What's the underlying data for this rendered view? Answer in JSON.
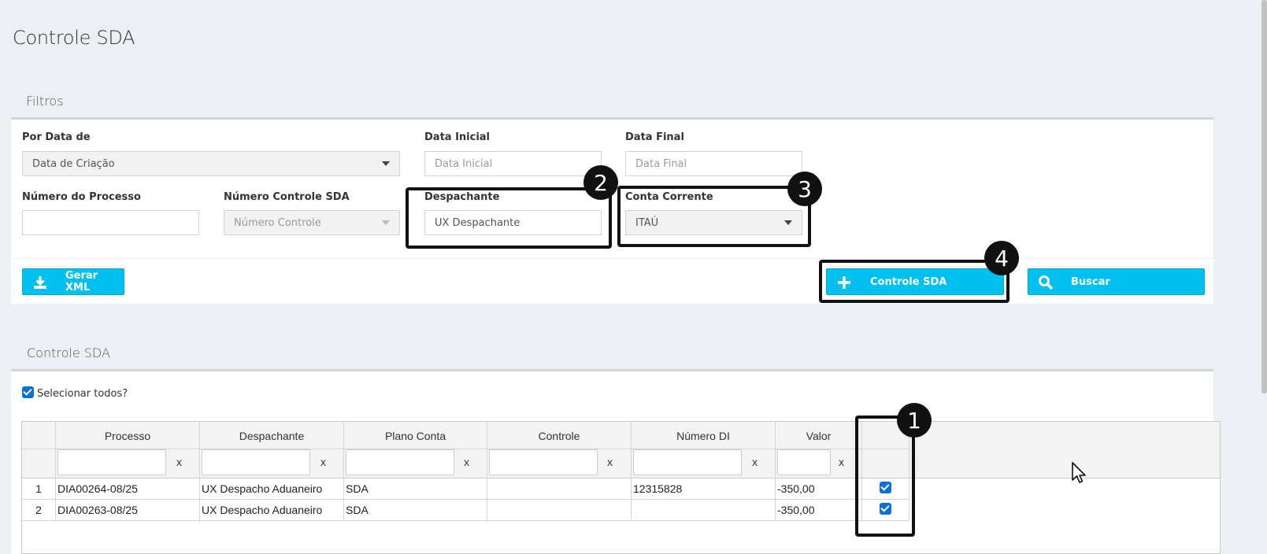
{
  "page": {
    "title": "Controle SDA"
  },
  "filters": {
    "section_title": "Filtros",
    "por_data_label": "Por Data de",
    "por_data_value": "Data de Criação",
    "data_inicial_label": "Data Inicial",
    "data_inicial_placeholder": "Data Inicial",
    "data_final_label": "Data Final",
    "data_final_placeholder": "Data Final",
    "numero_processo_label": "Número do Processo",
    "numero_processo_value": "",
    "numero_controle_label": "Número Controle SDA",
    "numero_controle_placeholder": "Número Controle",
    "despachante_label": "Despachante",
    "despachante_value": "UX Despachante",
    "conta_corrente_label": "Conta Corrente",
    "conta_corrente_value": "ITAÚ"
  },
  "actions": {
    "gerar_xml": "Gerar XML",
    "controle_sda": "Controle SDA",
    "buscar": "Buscar"
  },
  "results": {
    "section_title": "Controle SDA",
    "select_all_label": "Selecionar todos?",
    "select_all_checked": true,
    "columns": [
      "Processo",
      "Despachante",
      "Plano Conta",
      "Controle",
      "Número DI",
      "Valor"
    ],
    "filter_clear": "x",
    "rows": [
      {
        "n": "1",
        "processo": "DIA00264-08/25",
        "despachante": "UX Despacho Aduaneiro",
        "plano_conta": "SDA",
        "controle": "",
        "numero_di": "12315828",
        "valor": "-350,00",
        "checked": true
      },
      {
        "n": "2",
        "processo": "DIA00263-08/25",
        "despachante": "UX Despacho Aduaneiro",
        "plano_conta": "SDA",
        "controle": "",
        "numero_di": "",
        "valor": "-350,00",
        "checked": true
      }
    ]
  },
  "annotations": {
    "marker_1": "1",
    "marker_2": "2",
    "marker_3": "3",
    "marker_4": "4"
  },
  "colors": {
    "primary": "#00c0ef",
    "background": "#eceff3",
    "checkbox": "#0b6fd6",
    "highlight": "#111111"
  },
  "icons": [
    "download-icon",
    "plus-icon",
    "search-icon",
    "caret-down-icon",
    "mouse-cursor-icon"
  ]
}
